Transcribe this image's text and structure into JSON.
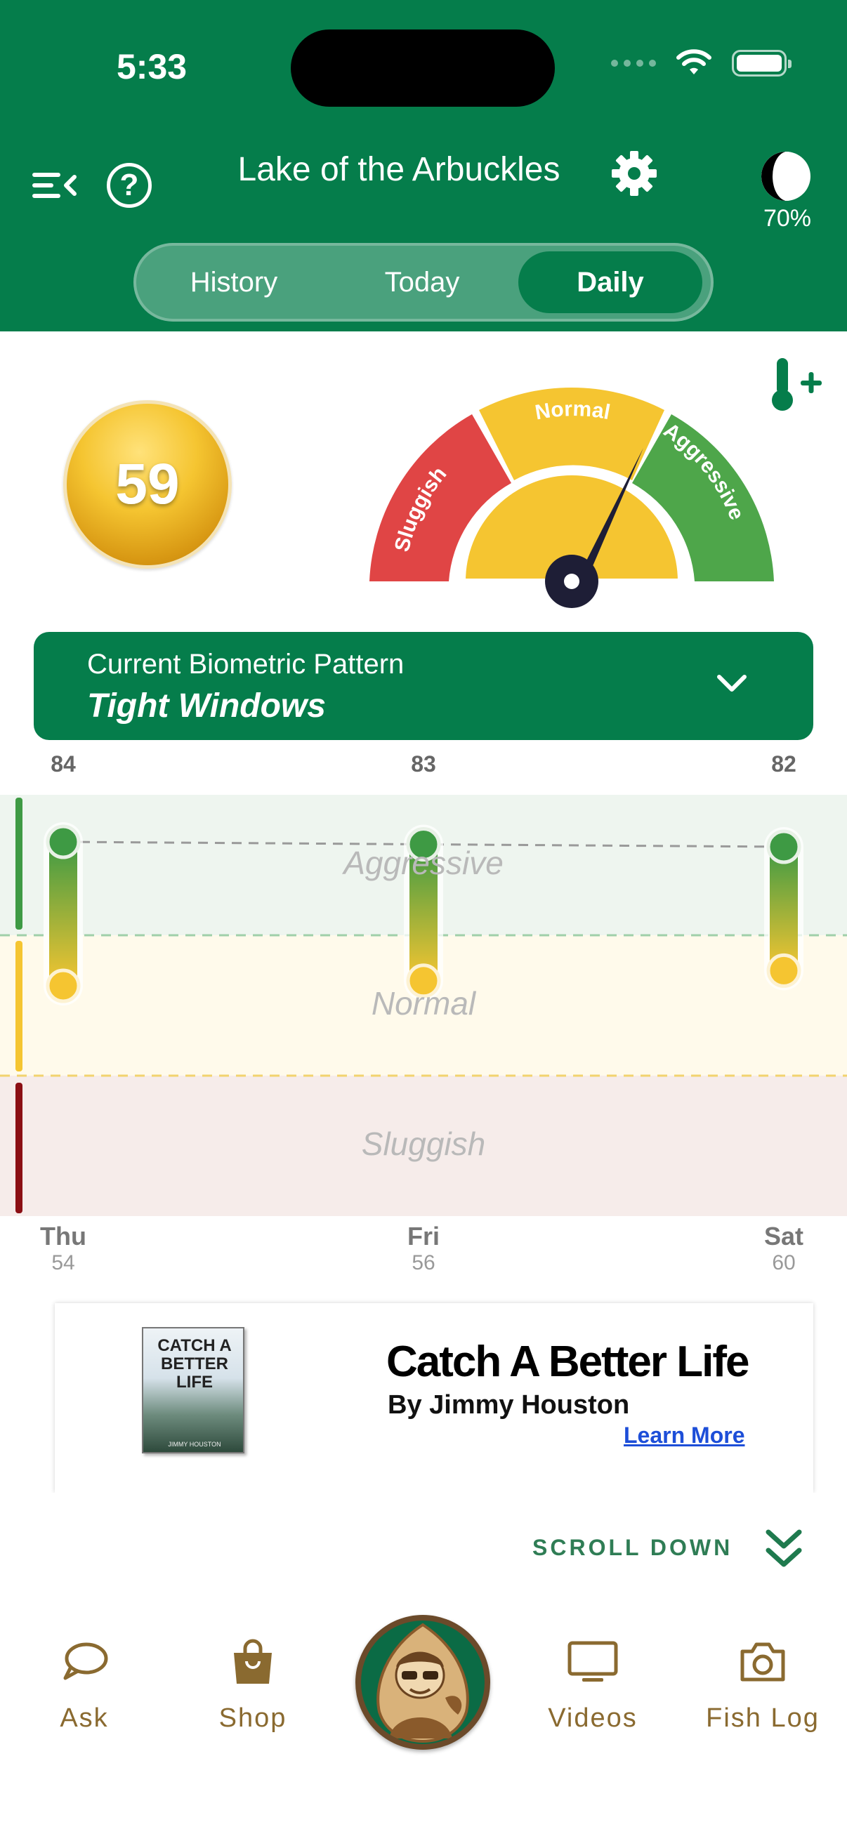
{
  "status_bar": {
    "time": "5:33"
  },
  "header": {
    "lake_name": "Lake of the Arbuckles",
    "moon_percent": "70%",
    "tabs": [
      {
        "label": "History",
        "active": false
      },
      {
        "label": "Today",
        "active": false
      },
      {
        "label": "Daily",
        "active": true
      }
    ]
  },
  "score": {
    "value": "59"
  },
  "gauge": {
    "zones": [
      "Sluggish",
      "Normal",
      "Aggressive"
    ],
    "zone_colors": {
      "sluggish": "#e04545",
      "normal": "#f5c531",
      "aggressive": "#4ea64a"
    },
    "needle_value": 0.8
  },
  "pattern": {
    "label": "Current Biometric Pattern",
    "value": "Tight Windows"
  },
  "daily_chart": {
    "bands": [
      "Aggressive",
      "Normal",
      "Sluggish"
    ],
    "days": [
      {
        "name": "Thu",
        "low": "54",
        "high": "84"
      },
      {
        "name": "Fri",
        "low": "56",
        "high": "83"
      },
      {
        "name": "Sat",
        "low": "60",
        "high": "82"
      }
    ]
  },
  "ad": {
    "book_title": "CATCH A BETTER LIFE",
    "book_author": "JIMMY HOUSTON",
    "headline": "Catch A Better Life",
    "subtitle": "By Jimmy Houston",
    "link": "Learn More"
  },
  "scroll_hint": "SCROLL DOWN",
  "tabbar": {
    "items": [
      {
        "label": "Ask",
        "icon": "chat-bubble-icon"
      },
      {
        "label": "Shop",
        "icon": "shopping-bag-icon"
      },
      {
        "label": "Videos",
        "icon": "monitor-icon"
      },
      {
        "label": "Fish Log",
        "icon": "camera-icon"
      }
    ]
  },
  "colors": {
    "brand_green": "#057d4b",
    "tab_gold": "#8a6a30"
  }
}
